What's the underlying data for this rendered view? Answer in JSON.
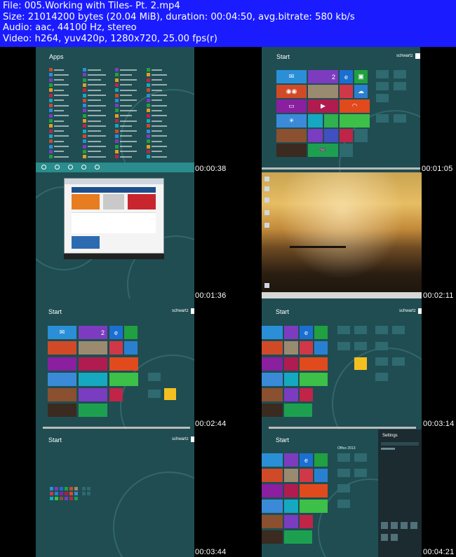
{
  "header": {
    "line1": "File: 005.Working with Tiles- Pt. 2.mp4",
    "line2": "Size: 21014200 bytes (20.04 MiB), duration: 00:04:50, avg.bitrate: 580 kb/s",
    "line3": "Audio: aac, 44100 Hz, stereo",
    "line4": "Video: h264, yuv420p, 1280x720, 25.00 fps(r)"
  },
  "thumbnails": [
    {
      "timestamp": "00:00:38",
      "title": "Apps"
    },
    {
      "timestamp": "00:01:05",
      "title": "Start",
      "user": "schwartz"
    },
    {
      "timestamp": "00:01:36"
    },
    {
      "timestamp": "00:02:11"
    },
    {
      "timestamp": "00:02:44",
      "title": "Start",
      "user": "schwartz"
    },
    {
      "timestamp": "00:03:14",
      "title": "Start",
      "user": "schwartz"
    },
    {
      "timestamp": "00:03:44",
      "title": "Start",
      "user": "schwartz"
    },
    {
      "timestamp": "00:04:21",
      "title": "Start",
      "settings_title": "Settings",
      "group": "Office 2013"
    }
  ],
  "tile_number": "2",
  "colors": {
    "header_bg": "#1a1cff",
    "metro_bg": "#1f4d52",
    "apps_bar": "#2a8c8c"
  }
}
